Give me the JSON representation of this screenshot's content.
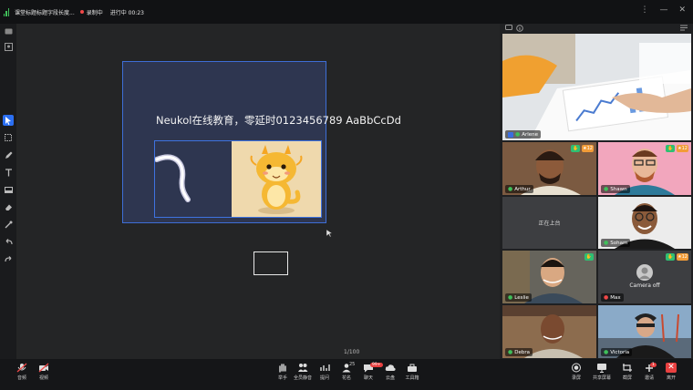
{
  "app": {
    "title": "课堂标题标题字段长度...",
    "recording": "录制中",
    "elapsed": "进行中 00:23",
    "window_controls": [
      "⋮",
      "—",
      "✕"
    ]
  },
  "board": {
    "text": "Neukol在线教育，零延时0123456789 AaBbCcDd",
    "page": "1/100"
  },
  "participants": [
    {
      "name": "Arlene",
      "mic": "on"
    },
    {
      "name": "Arthur",
      "mic": "on",
      "badge_count": "12"
    },
    {
      "name": "Shawn",
      "mic": "on",
      "badge_count": "12"
    },
    {
      "text": "正在上台"
    },
    {
      "name": "Soham",
      "mic": "on"
    },
    {
      "name": "Leslie",
      "mic": "on"
    },
    {
      "name": "Max",
      "mic": "off",
      "badge_count": "12",
      "status": "Camera off"
    },
    {
      "name": "Debra",
      "mic": "on"
    },
    {
      "name": "Victoria",
      "mic": "on"
    }
  ],
  "toolbar_left": [
    {
      "label": "音频",
      "icon": "mic-off-icon"
    },
    {
      "label": "视频",
      "icon": "camera-off-icon"
    }
  ],
  "toolbar_center": [
    {
      "label": "举手",
      "icon": "hand-icon"
    },
    {
      "label": "全员静音",
      "icon": "mute-all-icon"
    },
    {
      "label": "提问",
      "icon": "question-icon"
    },
    {
      "label": "花名",
      "icon": "roster-icon",
      "count": "25"
    },
    {
      "label": "聊天",
      "icon": "chat-icon",
      "badge": "99+"
    },
    {
      "label": "云盘",
      "icon": "cloud-icon"
    },
    {
      "label": "工具箱",
      "icon": "toolbox-icon"
    }
  ],
  "toolbar_right": [
    {
      "label": "录屏",
      "icon": "record-icon"
    },
    {
      "label": "共享屏幕",
      "icon": "share-screen-icon"
    },
    {
      "label": "截屏",
      "icon": "screenshot-icon"
    },
    {
      "label": "邀请",
      "icon": "invite-icon",
      "badge": "1"
    },
    {
      "label": "离开",
      "icon": "leave-icon"
    }
  ],
  "colors": {
    "accent": "#2b6ff2",
    "mic_on": "#3fbf5a",
    "mic_off": "#f04848",
    "selection": "#3e6ed6",
    "leave": "#e84040"
  }
}
